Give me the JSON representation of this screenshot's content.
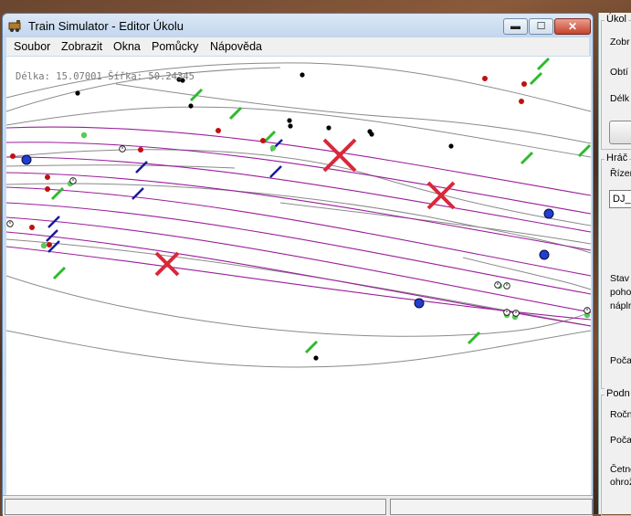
{
  "window": {
    "title": "Train Simulator - Editor Úkolu",
    "controls": {
      "minimize": "▬",
      "maximize": "☐",
      "close": "✕"
    }
  },
  "menu": [
    "Soubor",
    "Zobrazit",
    "Okna",
    "Pomůcky",
    "Nápověda"
  ],
  "map": {
    "coords": "Délka: 15.07001 Šířka: 50.24345"
  },
  "side_panel": {
    "group1": {
      "title": "Úkol",
      "labels": [
        "Zobr",
        "Obtí",
        "Délk"
      ]
    },
    "group2": {
      "title": "Hráč",
      "labels": [
        "Řízen",
        "Stav",
        "poho",
        "náplr",
        "Poča"
      ],
      "combo_value": "DJ_"
    },
    "group3": {
      "title": "Podn",
      "labels": [
        "Ročn",
        "Poča",
        "Četno",
        "ohrož"
      ]
    }
  },
  "colors": {
    "track_gray": "#8a8a8a",
    "track_purple": "#9b1f9b",
    "signal_green": "#2dbb2d",
    "marker_blue": "#1a1a9c",
    "cross_red": "#d8283a",
    "dot_red": "#c01010",
    "dot_black": "#000000"
  }
}
